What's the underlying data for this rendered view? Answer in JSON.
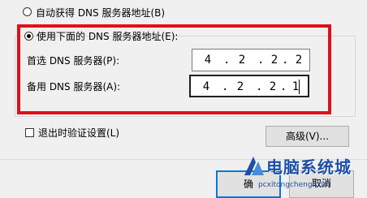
{
  "options": {
    "auto_dns_label": "自动获得 DNS 服务器地址(B)",
    "manual_dns_label": "使用下面的 DNS 服务器地址(E):"
  },
  "dns": {
    "preferred_label": "首选 DNS 服务器(P):",
    "preferred_octets": [
      "4",
      "2",
      "2",
      "2"
    ],
    "alternate_label": "备用 DNS 服务器(A):",
    "alternate_octets": [
      "4",
      "2",
      "2",
      "1"
    ],
    "dot": "."
  },
  "validate_on_exit_label": "退出时验证设置(L)",
  "buttons": {
    "advanced": "高级(V)...",
    "ok_partial": "确",
    "cancel": "取消"
  },
  "watermark": {
    "title": "电脑系统城",
    "url": "pcxitongcheng.com"
  },
  "colors": {
    "highlight": "#e0101a",
    "watermark": "#1e4fa6"
  }
}
